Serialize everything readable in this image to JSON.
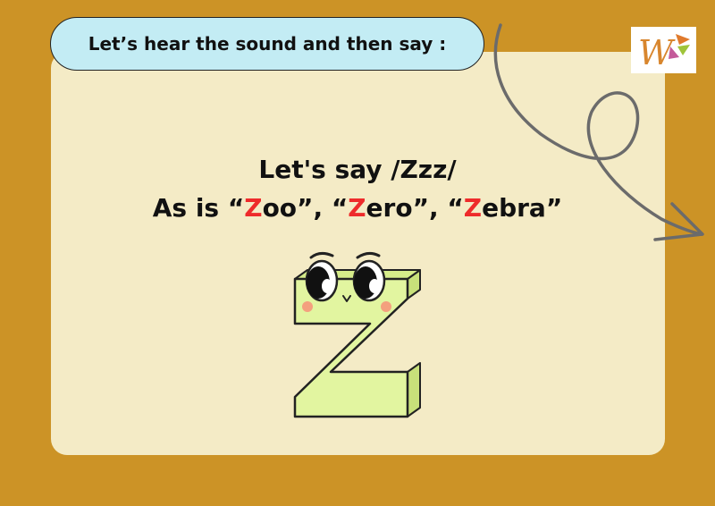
{
  "instruction": {
    "text": "Let’s hear the sound and then say :"
  },
  "logo": {
    "letter": "W"
  },
  "prompt": {
    "line1": "Let's say /Zzz/"
  },
  "examples": [
    {
      "open": "As is “",
      "highlight": "Z",
      "rest": "oo”, "
    },
    {
      "open": "“",
      "highlight": "Z",
      "rest": "ero”, "
    },
    {
      "open": "“",
      "highlight": "Z",
      "rest": "ebra”"
    }
  ],
  "colors": {
    "background": "#cc9326",
    "card": "#f4ebc6",
    "banner": "#c3ecf4",
    "highlight": "#ee2b2b",
    "letter": "#e2f5a0"
  }
}
